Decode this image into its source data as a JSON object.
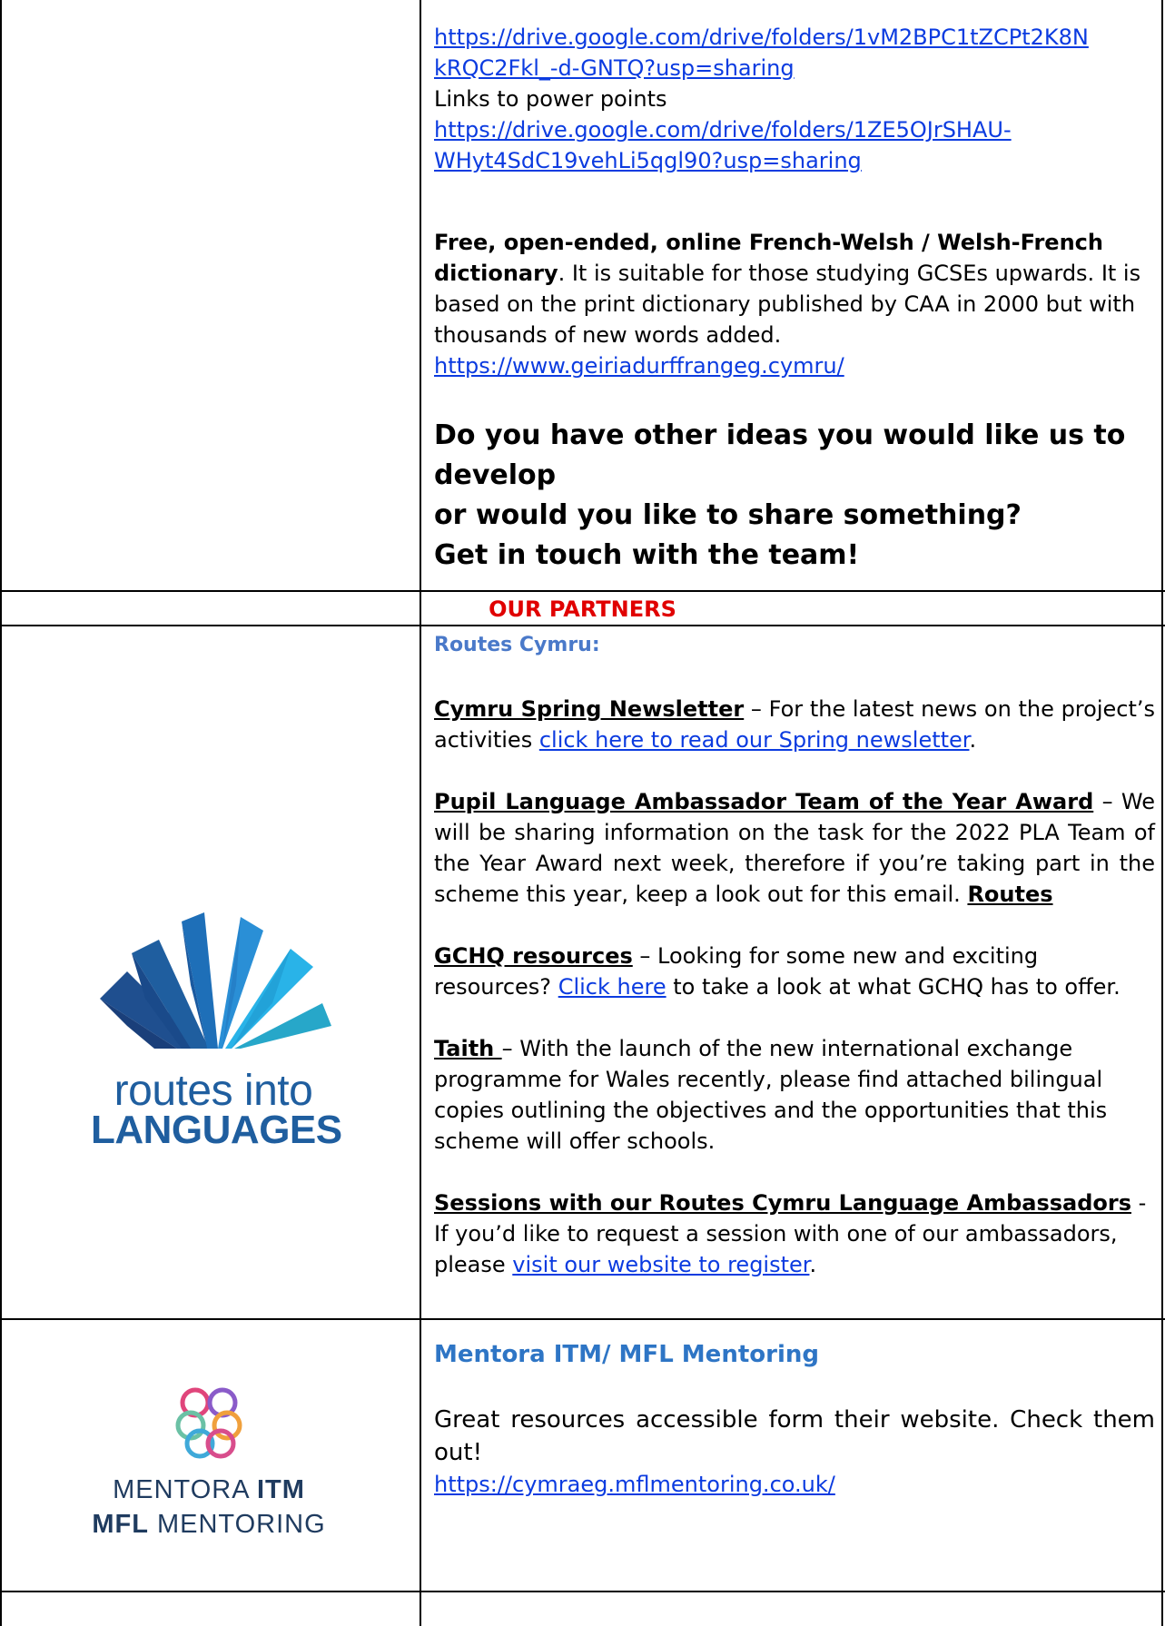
{
  "top_row": {
    "link1": "https://drive.google.com/drive/folders/1vM2BPC1tZCPt2K8NkRQC2Fkl_-d-GNTQ?usp=sharing",
    "link1_line1": "https://drive.google.com/drive/folders/1vM2BPC1tZCPt2K8N",
    "link1_line2": "kRQC2Fkl_-d-GNTQ?usp=sharing",
    "powerpoints_label": "Links to power points",
    "link2_line1": "https://drive.google.com/drive/folders/1ZE5OJrSHAU-",
    "link2_line2": "WHyt4SdC19vehLi5qgl90?usp=sharing",
    "dictionary_bold": "Free, open-ended, online French-Welsh / Welsh-French dictionary",
    "dictionary_text": ". It is suitable for those studying GCSEs upwards. It is based on the print dictionary published by CAA in 2000 but with thousands of new words added.",
    "dictionary_link": "https://www.geiriadurffrangeg.cymru/",
    "question_line1": "Do you have other ideas you would like us to develop",
    "question_line2": "or would you like to share something?",
    "question_line3": "Get in touch with the team!"
  },
  "partners_heading": "OUR PARTNERS",
  "routes": {
    "logo_line1": "routes into",
    "logo_line2": "LANGUAGES",
    "logo_colors": [
      "#1f5e9f",
      "#2a8fd6",
      "#29b3e8",
      "#1a4a8a"
    ],
    "heading": "Routes Cymru:",
    "newsletter_title": "Cymru Spring Newsletter",
    "newsletter_text": " – For the latest news on the project’s activities ",
    "newsletter_link": "click here to read our Spring newsletter",
    "newsletter_end": ".",
    "pla_title": "Pupil Language Ambassador Team of the Year Award",
    "pla_text": " – We will be sharing information on the task for the 2022 PLA Team of the Year Award next week, therefore if you’re taking part in the scheme this year, keep a look out for this email. ",
    "pla_routes": "Routes",
    "gchq_title": "GCHQ resources",
    "gchq_text1": " – Looking for some new and exciting resources?  ",
    "gchq_link": "Click here",
    "gchq_text2": " to take a look at what GCHQ has to offer.",
    "taith_title": "Taith ",
    "taith_text": "– With the launch of the new international exchange programme for Wales recently, please find attached bilingual copies outlining the objectives and the opportunities that this scheme will offer schools.",
    "sessions_title": "Sessions with our Routes Cymru Language Ambassadors",
    "sessions_text": " - If you’d like to request a session with one of our ambassadors, please ",
    "sessions_link": "visit our website to register",
    "sessions_end": "."
  },
  "mentora": {
    "logo_line1_a": "MENTORA ",
    "logo_line1_b": "ITM",
    "logo_line2_a": "MFL",
    "logo_line2_b": " MENTORING",
    "heading": "Mentora ITM/ MFL Mentoring",
    "text": "Great resources accessible form their website.  Check them out!",
    "link": "https://cymraeg.mflmentoring.co.uk/"
  }
}
